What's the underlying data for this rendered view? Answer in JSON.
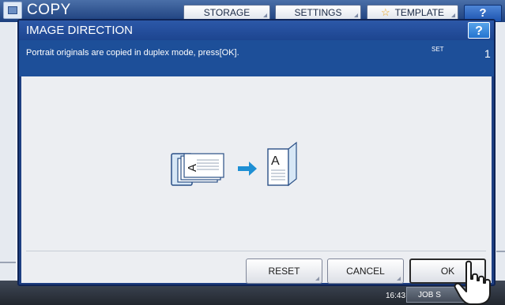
{
  "background": {
    "title": "COPY",
    "top_buttons": [
      "STORAGE",
      "SETTINGS",
      "TEMPLATE"
    ],
    "help_label": "?",
    "time": "16:43",
    "job_status_label": "JOB S"
  },
  "dialog": {
    "title": "IMAGE DIRECTION",
    "help_label": "?",
    "message": "Portrait originals are copied in duplex mode, press[OK].",
    "set_label": "SET",
    "set_number": "1",
    "buttons": {
      "reset": "RESET",
      "cancel": "CANCEL",
      "ok": "OK"
    },
    "illustration": {
      "original_letter": "A",
      "output_letter": "A"
    }
  },
  "icons": [
    "app-copy-icon",
    "star-icon",
    "arrow-right-icon",
    "pointer-hand-icon"
  ],
  "colors": {
    "dialog_title_bg": "#2c58a8",
    "message_bar_bg": "#1d4f99",
    "body_bg": "#eceef2",
    "accent_arrow": "#1e8fd4"
  }
}
